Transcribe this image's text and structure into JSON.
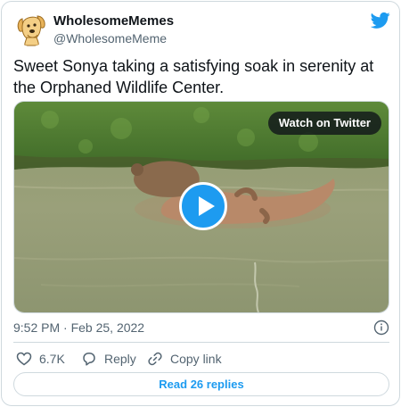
{
  "author": {
    "name": "WholesomeMemes",
    "handle": "@WholesomeMeme",
    "avatar_icon": "dog-avatar-icon"
  },
  "tweet": {
    "text": "Sweet Sonya taking a satisfying soak in serenity at the Orphaned Wildlife Center.",
    "timestamp": "9:52 PM · Feb 25, 2022"
  },
  "media": {
    "watch_label": "Watch on Twitter",
    "play_icon": "play-icon"
  },
  "actions": {
    "likes": "6.7K",
    "reply_label": "Reply",
    "copy_label": "Copy link"
  },
  "replies_button": "Read 26 replies",
  "colors": {
    "accent": "#1d9bf0",
    "secondary_text": "#536471",
    "border": "#cfd9de"
  }
}
